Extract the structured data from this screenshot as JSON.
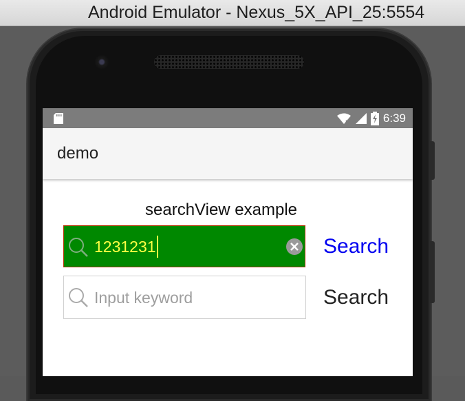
{
  "window": {
    "title": "Android Emulator - Nexus_5X_API_25:5554"
  },
  "statusbar": {
    "time": "6:39",
    "icons": [
      "sd-card-icon",
      "wifi-icon",
      "signal-icon",
      "battery-charging-icon"
    ]
  },
  "appbar": {
    "title": "demo"
  },
  "main": {
    "heading": "searchView example",
    "search1": {
      "value": "1231231",
      "button_label": "Search",
      "button_color": "#0000f0",
      "field_color": "#008800",
      "text_color": "#ffff44"
    },
    "search2": {
      "placeholder": "Input keyword",
      "button_label": "Search",
      "button_color": "#222222"
    }
  }
}
